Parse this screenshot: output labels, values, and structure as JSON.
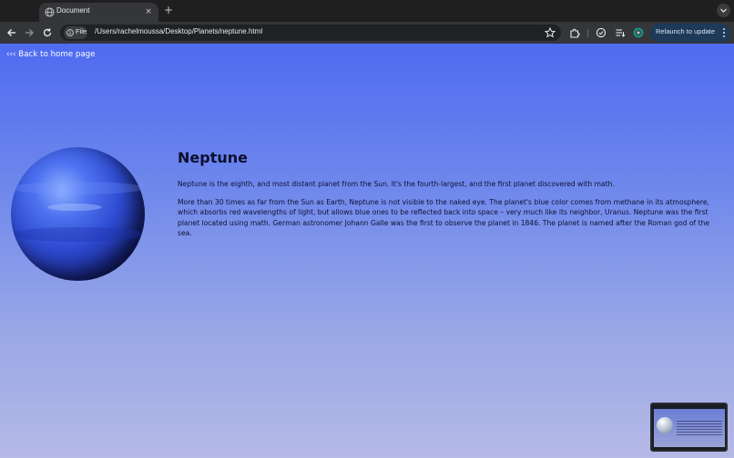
{
  "browser": {
    "tab": {
      "title": "Document",
      "close_glyph": "×",
      "favicon": "globe-icon"
    },
    "new_tab_glyph": "+",
    "address": {
      "chip_label": "File",
      "url": "/Users/rachelmoussa/Desktop/Planets/neptune.html"
    },
    "relaunch_label": "Relaunch to update",
    "accent": "#1d3a58"
  },
  "page": {
    "back_link": "‹‹‹ Back to home page",
    "title": "Neptune",
    "paragraphs": [
      "Neptune is the eighth, and most distant planet from the Sun. It's the fourth-largest, and the first planet discovered with math.",
      "More than 30 times as far from the Sun as Earth, Neptune is not visible to the naked eye. The planet's blue color comes from methane in its atmosphere, which absorbs red wavelengths of light, but allows blue ones to be reflected back into space – very much like its neighbor, Uranus. Neptune was the first planet located using math. German astronomer Johann Galle was the first to observe the planet in 1846. The planet is named after the Roman god of the sea."
    ],
    "background_top": "#4f6bf1",
    "background_bottom": "#b5b9e6"
  }
}
